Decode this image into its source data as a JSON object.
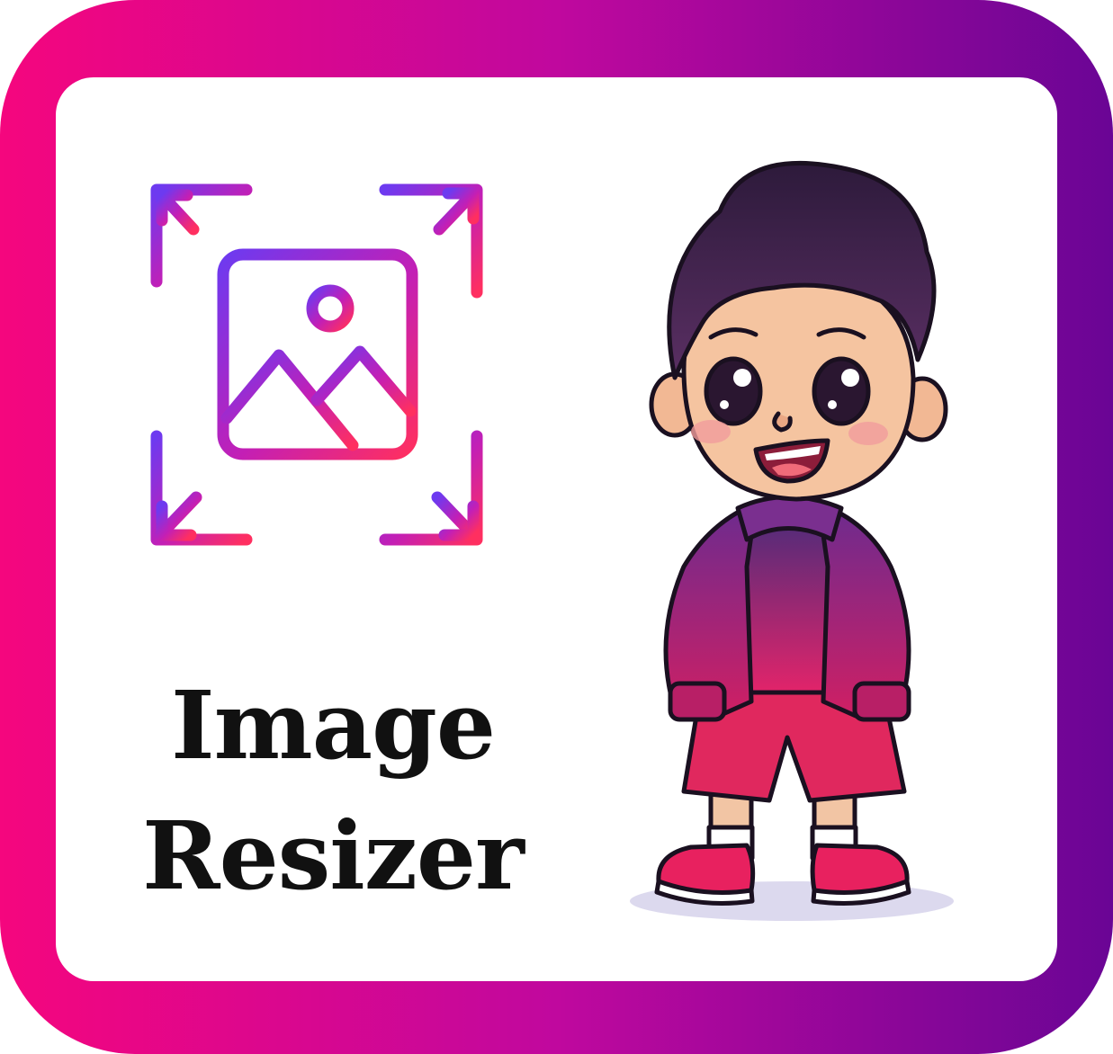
{
  "title": {
    "line1": "Image",
    "line2": "Resizer"
  },
  "icon": {
    "name": "image-resize-icon"
  },
  "mascot": {
    "name": "cartoon-boy-mascot"
  },
  "colors": {
    "frame_start": "#f5067e",
    "frame_mid": "#c0089e",
    "frame_end": "#6a0595",
    "icon_gradient_start": "#7a3cf0",
    "icon_gradient_end": "#ff2a6a",
    "text": "#111111"
  }
}
